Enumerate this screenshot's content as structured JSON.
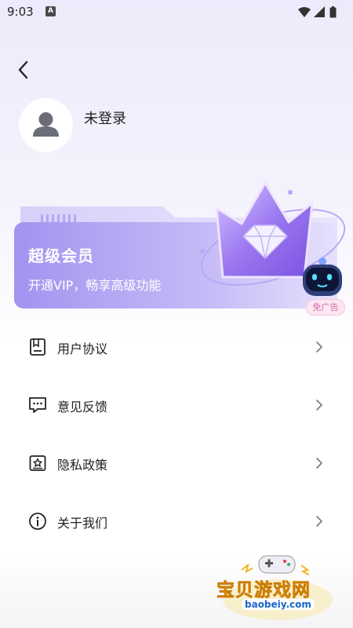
{
  "status_bar": {
    "time": "9:03",
    "notification_letter": "A",
    "icons": [
      "wifi-icon",
      "signal-icon",
      "battery-icon"
    ]
  },
  "header": {
    "back_icon": "back-arrow-icon"
  },
  "profile": {
    "name": "未登录",
    "avatar_icon": "user-silhouette-icon"
  },
  "vip": {
    "title": "超级会员",
    "subtitle": "开通VIP，畅享高级功能",
    "badge": "免广告",
    "colors": {
      "card": "#A99BF2",
      "card_light": "#D9D2FB"
    }
  },
  "menu": {
    "items": [
      {
        "label": "用户协议",
        "icon": "document-icon"
      },
      {
        "label": "意见反馈",
        "icon": "feedback-icon"
      },
      {
        "label": "隐私政策",
        "icon": "privacy-icon"
      },
      {
        "label": "关于我们",
        "icon": "info-icon"
      }
    ]
  },
  "watermark": {
    "title": "宝贝游戏网",
    "url": "baobeiy.com"
  }
}
